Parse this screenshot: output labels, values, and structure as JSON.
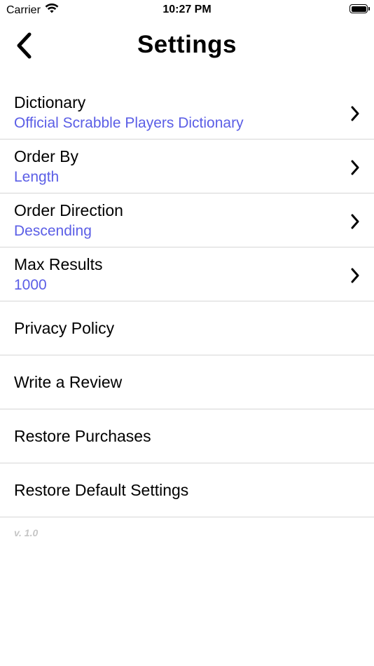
{
  "status_bar": {
    "carrier": "Carrier",
    "time": "10:27 PM",
    "wifi_icon": "wifi-icon",
    "battery_icon": "battery-icon"
  },
  "nav": {
    "title": "Settings",
    "back_icon": "chevron-left-icon"
  },
  "settings": {
    "dictionary": {
      "label": "Dictionary",
      "value": "Official Scrabble Players Dictionary"
    },
    "order_by": {
      "label": "Order By",
      "value": "Length"
    },
    "order_direction": {
      "label": "Order Direction",
      "value": "Descending"
    },
    "max_results": {
      "label": "Max Results",
      "value": "1000"
    },
    "privacy_policy": {
      "label": "Privacy Policy"
    },
    "write_review": {
      "label": "Write a Review"
    },
    "restore_purchases": {
      "label": "Restore Purchases"
    },
    "restore_defaults": {
      "label": "Restore Default Settings"
    }
  },
  "footer": {
    "version": "v. 1.0"
  },
  "colors": {
    "accent": "#5b5ee6",
    "separator": "#d6d6d6",
    "version_text": "#c6c6c6"
  }
}
